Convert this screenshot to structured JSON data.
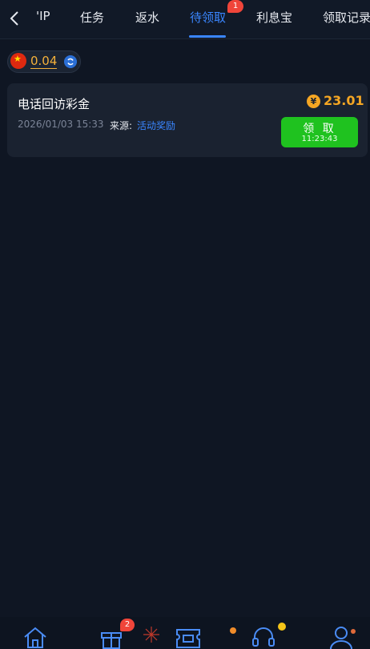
{
  "header": {
    "tabs": [
      {
        "label": "'IP"
      },
      {
        "label": "任务"
      },
      {
        "label": "返水"
      },
      {
        "label": "待领取",
        "badge": "1",
        "active": true
      },
      {
        "label": "利息宝"
      },
      {
        "label": "领取记录"
      }
    ]
  },
  "balance": {
    "value": "0.04",
    "currency_icon": "china-flag-icon"
  },
  "reward": {
    "title": "电话回访彩金",
    "date": "2026/01/03 15:33",
    "source_label": "来源:",
    "source": "活动奖励",
    "amount": "23.01",
    "coin_symbol": "¥",
    "claim_label": "领 取",
    "timer": "11:23:43"
  },
  "bottom_nav": {
    "gift_badge": "2",
    "icons": [
      "home-icon",
      "gift-icon",
      "ticket-icon",
      "support-icon",
      "profile-icon"
    ]
  },
  "colors": {
    "accent": "#3a86ff",
    "claim": "#1fc21f",
    "gold": "#f5a623",
    "badge": "#f0453a"
  }
}
